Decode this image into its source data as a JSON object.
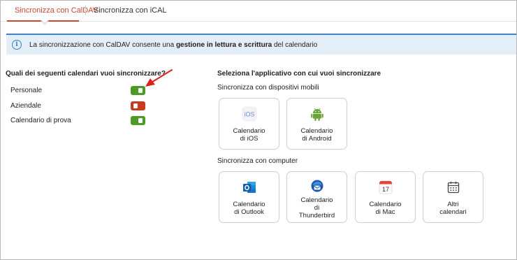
{
  "tabs": [
    {
      "label": "Sincronizza con CalDAV",
      "active": true
    },
    {
      "label": "Sincronizza con iCAL",
      "active": false
    }
  ],
  "banner": {
    "text_prefix": "La sincronizzazione con CalDAV consente una ",
    "text_bold": "gestione in lettura e scrittura",
    "text_suffix": " del calendario"
  },
  "calendars": {
    "title": "Quali dei seguenti calendari vuoi sincronizzare?",
    "items": [
      {
        "label": "Personale",
        "enabled": true
      },
      {
        "label": "Aziendale",
        "enabled": false
      },
      {
        "label": "Calendario di prova",
        "enabled": true
      }
    ]
  },
  "apps": {
    "title": "Seleziona l'applicativo con cui vuoi sincronizzare",
    "mobile": {
      "label": "Sincronizza con dispositivi mobili",
      "items": [
        {
          "label": "Calendario\ndi iOS",
          "icon": "ios-icon"
        },
        {
          "label": "Calendario\ndi Android",
          "icon": "android-icon"
        }
      ]
    },
    "computer": {
      "label": "Sincronizza con computer",
      "items": [
        {
          "label": "Calendario\ndi Outlook",
          "icon": "outlook-icon"
        },
        {
          "label": "Calendario\ndi\nThunderbird",
          "icon": "thunderbird-icon"
        },
        {
          "label": "Calendario\ndi Mac",
          "icon": "mac-calendar-icon"
        },
        {
          "label": "Altri\ncalendari",
          "icon": "calendar-icon"
        }
      ]
    }
  },
  "mac_calendar_day": "17",
  "ios_icon_text": "iOS",
  "colors": {
    "accent": "#c9482f",
    "toggle_on": "#4e9a26",
    "toggle_off": "#c63c1e",
    "info": "#3b7fc4",
    "banner_bg": "#e3eef8"
  }
}
